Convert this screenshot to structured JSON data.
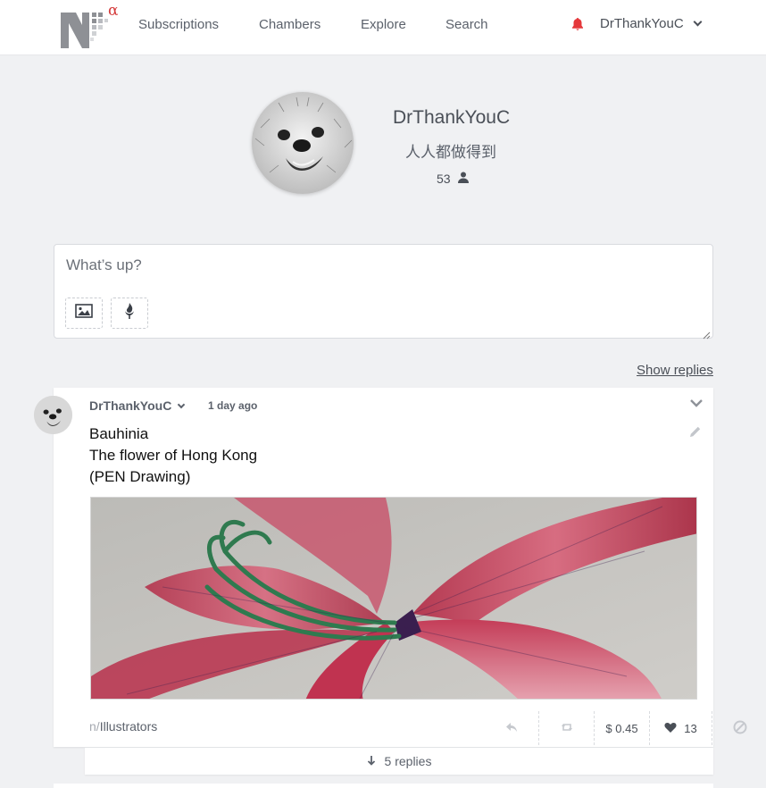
{
  "header": {
    "logo_letter": "N",
    "logo_superscript": "α",
    "nav": [
      {
        "label": "Subscriptions"
      },
      {
        "label": "Chambers"
      },
      {
        "label": "Explore"
      },
      {
        "label": "Search"
      }
    ],
    "username": "DrThankYouC",
    "icons": {
      "notifications": "bell-icon",
      "menu": "chevron-down-icon"
    },
    "accent_color": "#e5383b"
  },
  "profile": {
    "name": "DrThankYouC",
    "motto": "人人都做得到",
    "followers": "53",
    "followers_icon": "user-icon"
  },
  "composer": {
    "placeholder": "What’s up?",
    "buttons": [
      {
        "icon": "image-icon"
      },
      {
        "icon": "torch-icon"
      }
    ]
  },
  "show_replies_label": "Show replies",
  "post": {
    "author": "DrThankYouC",
    "time": "1 day ago",
    "lines": [
      "Bauhinia",
      "The flower of Hong Kong",
      "(PEN Drawing)"
    ],
    "chamber_prefix": "n/",
    "chamber": "Illustrators",
    "actions": {
      "reply_icon": "reply-icon",
      "repost_icon": "repost-icon",
      "value": "$ 0.45",
      "likes": "13",
      "like_icon": "heart-icon",
      "block_icon": "block-icon"
    },
    "replies_label": "5 replies",
    "image_icon": "bauhinia-drawing"
  }
}
